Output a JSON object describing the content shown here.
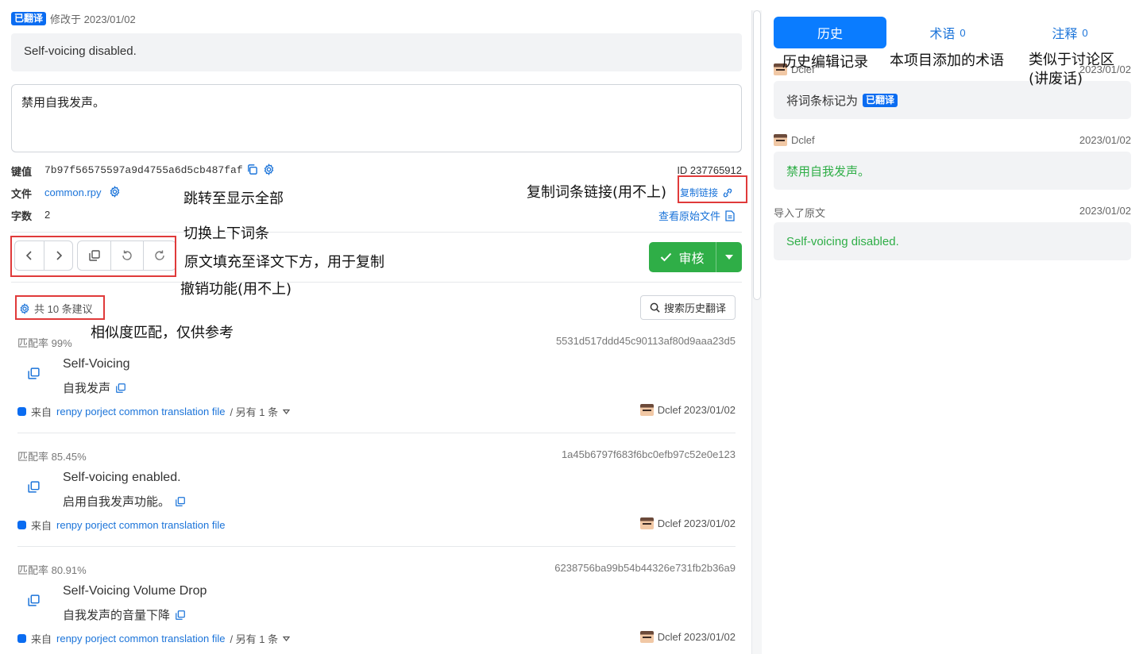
{
  "header": {
    "status_tag": "已翻译",
    "modified": "修改于 2023/01/02"
  },
  "source_text": "Self-voicing disabled.",
  "translation_text": "禁用自我发声。",
  "info": {
    "key_label": "键值",
    "key_value": "7b97f56575597a9d4755a6d5cb487faf",
    "id_text": "ID 237765912",
    "file_label": "文件",
    "file_value": "common.rpy",
    "copy_link_label": "复制链接",
    "chars_label": "字数",
    "chars_value": "2",
    "view_original_label": "查看原始文件"
  },
  "toolbar": {
    "review_label": "审核",
    "prev_icon": "chevron-left-icon",
    "next_icon": "chevron-right-icon",
    "copy_icon": "copy-source-icon",
    "undo_icon": "undo-icon",
    "redo_icon": "redo-icon"
  },
  "suggestions_header": {
    "count_label": "共 10 条建议",
    "search_history_label": "搜索历史翻译"
  },
  "suggestions": [
    {
      "rate": "匹配率 99%",
      "hash": "5531d517ddd45c90113af80d9aaa23d5",
      "source": "Self-Voicing",
      "target": "自我发声",
      "from_prefix": "来自",
      "from_project": "renpy porject common translation file",
      "more": "/ 另有 1 条",
      "user_date": "Dclef 2023/01/02"
    },
    {
      "rate": "匹配率 85.45%",
      "hash": "1a45b6797f683f6bc0efb97c52e0e123",
      "source": "Self-voicing enabled.",
      "target": "启用自我发声功能。",
      "from_prefix": "来自",
      "from_project": "renpy porject common translation file",
      "more": "",
      "user_date": "Dclef 2023/01/02"
    },
    {
      "rate": "匹配率 80.91%",
      "hash": "6238756ba99b54b44326e731fb2b36a9",
      "source": "Self-Voicing Volume Drop",
      "target": "自我发声的音量下降",
      "from_prefix": "来自",
      "from_project": "renpy porject common translation file",
      "more": "/ 另有 1 条",
      "user_date": "Dclef 2023/01/02"
    }
  ],
  "right_panel": {
    "tabs": [
      {
        "label": "历史",
        "count": ""
      },
      {
        "label": "术语",
        "count": "0"
      },
      {
        "label": "注释",
        "count": "0"
      }
    ],
    "history": [
      {
        "user": "Dclef",
        "date": "2023/01/02",
        "text": "将词条标记为",
        "tag": "已翻译"
      },
      {
        "user": "Dclef",
        "date": "2023/01/02",
        "text": "禁用自我发声。"
      },
      {
        "user": "导入了原文",
        "date": "2023/01/02",
        "text": "Self-voicing disabled."
      }
    ]
  },
  "annotations": {
    "history_tab": "历史编辑记录",
    "terms_tab": "本项目添加的术语",
    "notes_tab_line1": "类似于讨论区",
    "notes_tab_line2": "(讲废话)",
    "show_all": "跳转至显示全部",
    "copy_link": "复制词条链接(用不上)",
    "switch": "切换上下词条",
    "fill_source": "原文填充至译文下方，用于复制",
    "undo": "撤销功能(用不上)",
    "similarity": "相似度匹配，仅供参考"
  },
  "colors": {
    "primary": "#0a7cff",
    "success": "#2fae47",
    "annotation_border": "#e03a3a"
  }
}
